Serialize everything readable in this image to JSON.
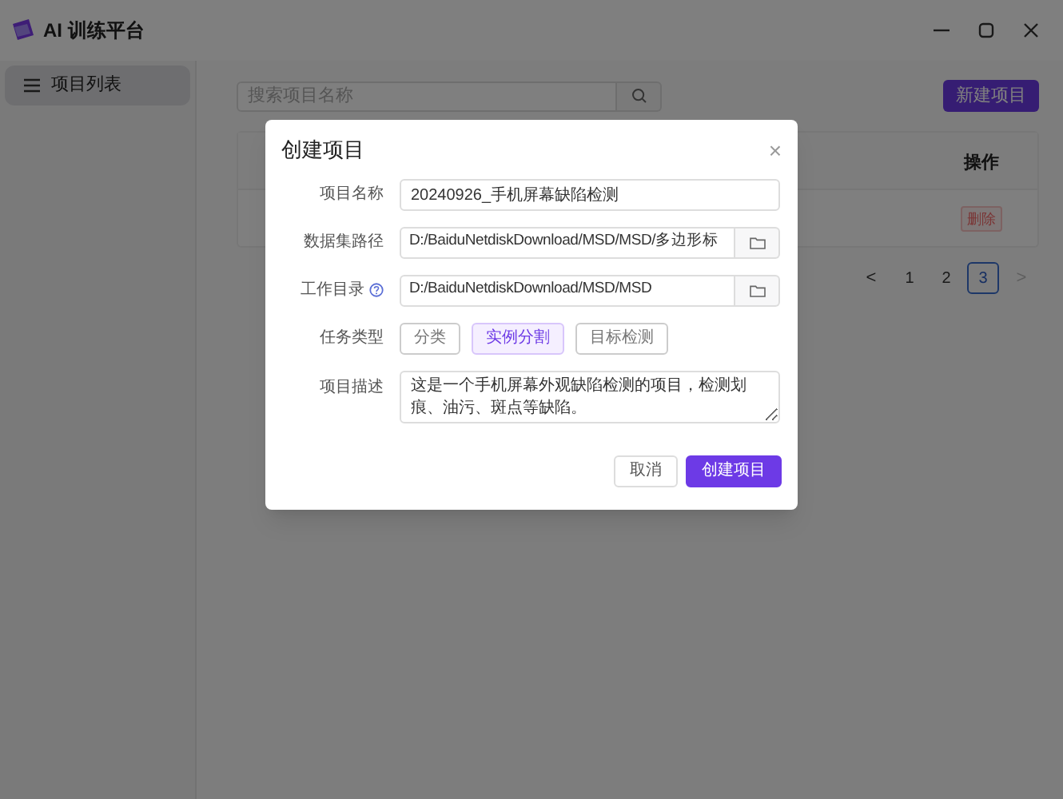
{
  "window": {
    "title": "AI 训练平台"
  },
  "sidebar": {
    "items": [
      {
        "label": "项目列表",
        "selected": true
      }
    ]
  },
  "toolbar": {
    "search": {
      "placeholder": "搜索项目名称"
    },
    "new_button": "新建项目"
  },
  "table": {
    "columns": [
      {
        "label": "操作"
      }
    ],
    "rows": [
      {
        "action": "删除"
      }
    ]
  },
  "pagination": {
    "prev": "<",
    "next": ">",
    "next_disabled": true,
    "pages": [
      {
        "label": "1",
        "selected": false
      },
      {
        "label": "2",
        "selected": false
      },
      {
        "label": "3",
        "selected": true
      }
    ]
  },
  "dialog": {
    "title": "创建项目",
    "close": "×",
    "fields": [
      {
        "kind": "text",
        "label": "项目名称",
        "value": "20240926_手机屏幕缺陷检测"
      },
      {
        "kind": "path",
        "label": "数据集路径",
        "value": "D:/BaiduNetdiskDownload/MSD/MSD/多边形标"
      },
      {
        "kind": "path",
        "label": "工作目录",
        "help": true,
        "value": "D:/BaiduNetdiskDownload/MSD/MSD"
      },
      {
        "kind": "choice",
        "label": "任务类型",
        "options": [
          {
            "label": "分类",
            "selected": false
          },
          {
            "label": "实例分割",
            "selected": true
          },
          {
            "label": "目标检测",
            "selected": false
          }
        ]
      },
      {
        "kind": "textarea",
        "label": "项目描述",
        "value": "这是一个手机屏幕外观缺陷检测的项目，检测划痕、油污、斑点等缺陷。"
      }
    ],
    "buttons": [
      {
        "kind": "secondary",
        "label": "取消"
      },
      {
        "kind": "primary",
        "label": "创建项目"
      }
    ]
  }
}
